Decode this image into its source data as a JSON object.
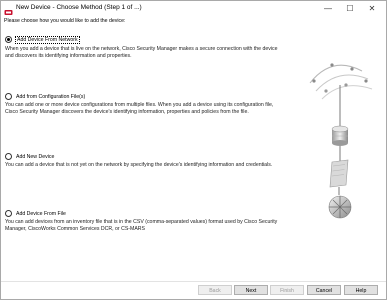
{
  "window": {
    "title": "New Device - Choose Method (Step 1 of ...)",
    "minimize_glyph": "—",
    "maximize_glyph": "☐",
    "close_glyph": "✕"
  },
  "prompt": "Please choose how you would like to add the device:",
  "options": [
    {
      "label": "Add Device From Network",
      "selected": true,
      "description": "When you add a device that is live on the network, Cisco Security Manager makes a secure connection with the device and discovers its identifying information and properties."
    },
    {
      "label": "Add from Configuration File(s)",
      "selected": false,
      "description": "You can add one or more device configurations from multiple files. When you add a device using its configuration file, Cisco Security Manager discovers the device's identifying information, properties and policies from the file."
    },
    {
      "label": "Add New Device",
      "selected": false,
      "description": "You can add a device that is not yet on the network by specifying the device's identifying information and credentials."
    },
    {
      "label": "Add Device From File",
      "selected": false,
      "description": "You can add devices from an inventory file that is in the CSV (comma-separated values) format used by Cisco Security Manager, CiscoWorks Common Services DCR, or CS-MARS"
    }
  ],
  "buttons": {
    "back": "Back",
    "next": "Next",
    "finish": "Finish",
    "cancel": "Cancel",
    "help": "Help"
  },
  "colors": {
    "accent": "#0078d7",
    "button_bg": "#e1e1e1",
    "disabled_text": "#9a9a9a"
  }
}
